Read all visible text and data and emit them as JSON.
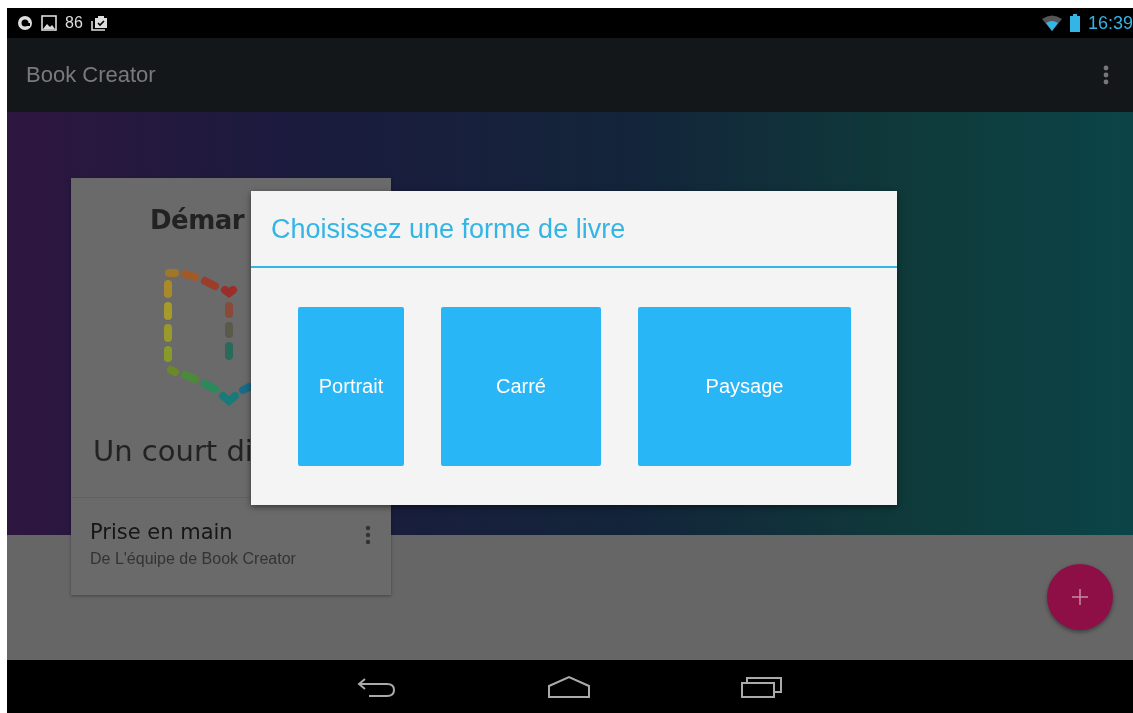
{
  "status_bar": {
    "notification_count": "86",
    "time": "16:39"
  },
  "app_bar": {
    "title": "Book Creator"
  },
  "book_card": {
    "cover_title": "Démar",
    "cover_subtitle": "Un court di",
    "name": "Prise en main",
    "author": "De L'équipe de Book Creator"
  },
  "dialog": {
    "title": "Choisissez une forme de livre",
    "options": [
      {
        "label": "Portrait",
        "kind": "portrait"
      },
      {
        "label": "Carré",
        "kind": "square"
      },
      {
        "label": "Paysage",
        "kind": "landscape"
      }
    ]
  }
}
